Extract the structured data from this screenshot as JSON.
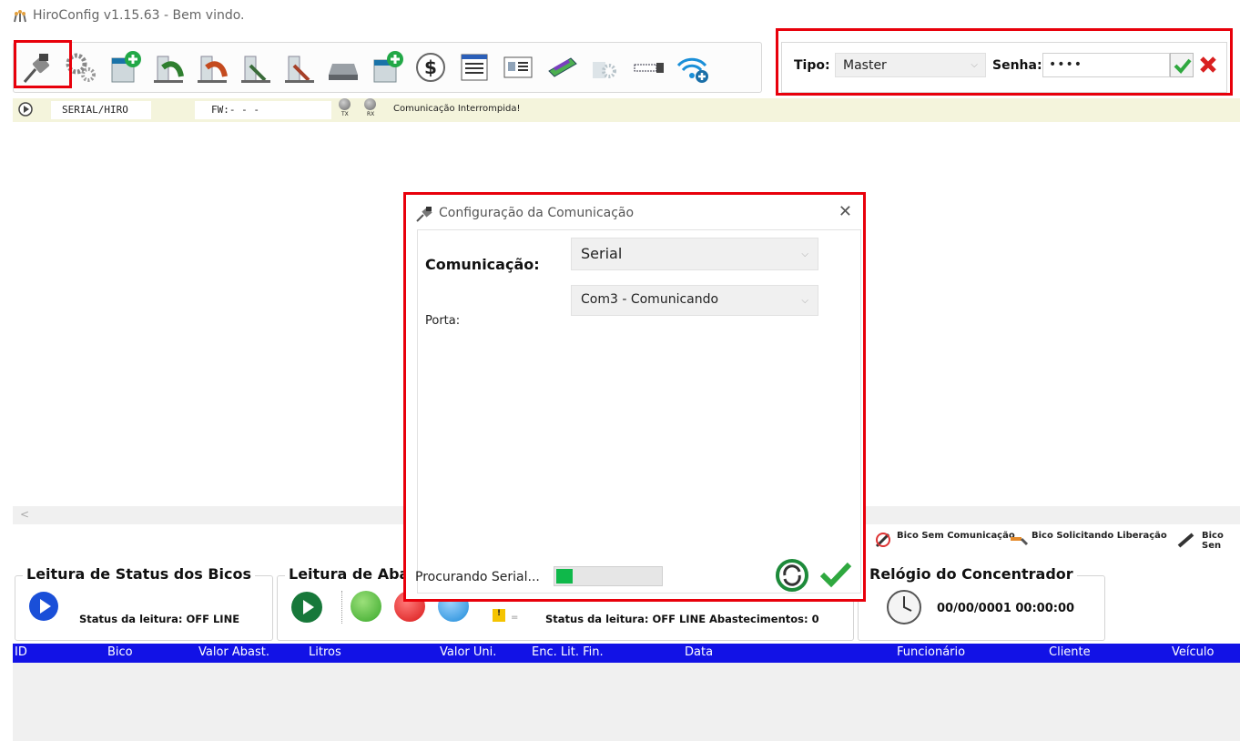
{
  "window": {
    "title": "HiroConfig v1.15.63 - Bem vindo."
  },
  "toolbar": {
    "items": [
      {
        "name": "comunicacao-plug-icon"
      },
      {
        "name": "gears-icon"
      },
      {
        "name": "add-device-icon"
      },
      {
        "name": "nozzle-config-icon"
      },
      {
        "name": "nozzle-red-icon"
      },
      {
        "name": "nozzle-down-icon"
      },
      {
        "name": "nozzle-gray-icon"
      },
      {
        "name": "printer-icon"
      },
      {
        "name": "add-card-icon"
      },
      {
        "name": "price-dollar-icon"
      },
      {
        "name": "document-list-icon"
      },
      {
        "name": "id-card-icon"
      },
      {
        "name": "memory-module-icon"
      },
      {
        "name": "disabled-gear-icon"
      },
      {
        "name": "cable-icon"
      },
      {
        "name": "wifi-add-icon"
      }
    ]
  },
  "login": {
    "tipo_label": "Tipo:",
    "tipo_value": "Master",
    "senha_label": "Senha:",
    "senha_value": "••••"
  },
  "status_strip": {
    "port": "SERIAL/HIRO",
    "fw": "FW:- - -",
    "tx": "TX",
    "rx": "RX",
    "message": "Comunicação Interrompida!"
  },
  "legend": {
    "sem_comunicacao": "Bico Sem Comunicação",
    "solicitando": "Bico Solicitando Liberação",
    "sem": "Bico Sen"
  },
  "status_bicos": {
    "title": "Leitura de Status dos Bicos",
    "status": "Status da leitura: OFF LINE"
  },
  "abastecimentos": {
    "title": "Leitura de Aba",
    "status": "Status da leitura: OFF LINE",
    "count": "Abastecimentos: 0",
    "mark": "!",
    "tick": "="
  },
  "relogio": {
    "title": "Relógio do Concentrador",
    "datetime": "00/00/0001 00:00:00"
  },
  "table": {
    "columns": [
      "ID",
      "Bico",
      "Valor Abast.",
      "Litros",
      "Valor Uni.",
      "Enc. Lit. Fin.",
      "Data",
      "Funcionário",
      "Cliente",
      "Veículo"
    ]
  },
  "dialog": {
    "title": "Configuração da Comunicação",
    "comunicacao_label": "Comunicação:",
    "comunicacao_value": "Serial",
    "porta_label": "Porta:",
    "porta_value": "Com3 - Comunicando",
    "progress_label": "Procurando Serial...",
    "progress": 0.08,
    "close": "✕"
  },
  "colors": {
    "highlight": "#e8000b",
    "table_header": "#1212e6",
    "green": "#0fb84a"
  }
}
